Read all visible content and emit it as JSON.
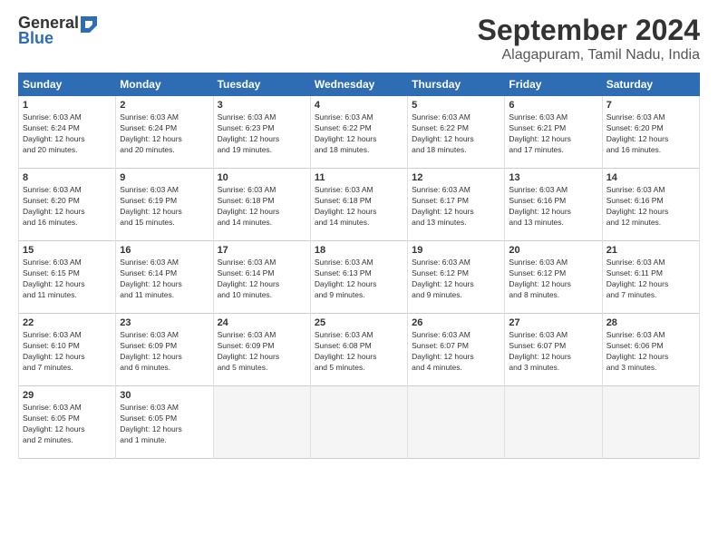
{
  "header": {
    "logo_line1": "General",
    "logo_line2": "Blue",
    "title": "September 2024",
    "subtitle": "Alagapuram, Tamil Nadu, India"
  },
  "calendar": {
    "days_of_week": [
      "Sunday",
      "Monday",
      "Tuesday",
      "Wednesday",
      "Thursday",
      "Friday",
      "Saturday"
    ],
    "weeks": [
      [
        null,
        {
          "day": "2",
          "sunrise": "Sunrise: 6:03 AM",
          "sunset": "Sunset: 6:24 PM",
          "daylight": "Daylight: 12 hours and 20 minutes."
        },
        {
          "day": "3",
          "sunrise": "Sunrise: 6:03 AM",
          "sunset": "Sunset: 6:23 PM",
          "daylight": "Daylight: 12 hours and 19 minutes."
        },
        {
          "day": "4",
          "sunrise": "Sunrise: 6:03 AM",
          "sunset": "Sunset: 6:22 PM",
          "daylight": "Daylight: 12 hours and 18 minutes."
        },
        {
          "day": "5",
          "sunrise": "Sunrise: 6:03 AM",
          "sunset": "Sunset: 6:22 PM",
          "daylight": "Daylight: 12 hours and 18 minutes."
        },
        {
          "day": "6",
          "sunrise": "Sunrise: 6:03 AM",
          "sunset": "Sunset: 6:21 PM",
          "daylight": "Daylight: 12 hours and 17 minutes."
        },
        {
          "day": "7",
          "sunrise": "Sunrise: 6:03 AM",
          "sunset": "Sunset: 6:20 PM",
          "daylight": "Daylight: 12 hours and 16 minutes."
        }
      ],
      [
        {
          "day": "1",
          "sunrise": "Sunrise: 6:03 AM",
          "sunset": "Sunset: 6:24 PM",
          "daylight": "Daylight: 12 hours and 20 minutes."
        },
        {
          "day": "9",
          "sunrise": "Sunrise: 6:03 AM",
          "sunset": "Sunset: 6:19 PM",
          "daylight": "Daylight: 12 hours and 15 minutes."
        },
        {
          "day": "10",
          "sunrise": "Sunrise: 6:03 AM",
          "sunset": "Sunset: 6:18 PM",
          "daylight": "Daylight: 12 hours and 14 minutes."
        },
        {
          "day": "11",
          "sunrise": "Sunrise: 6:03 AM",
          "sunset": "Sunset: 6:18 PM",
          "daylight": "Daylight: 12 hours and 14 minutes."
        },
        {
          "day": "12",
          "sunrise": "Sunrise: 6:03 AM",
          "sunset": "Sunset: 6:17 PM",
          "daylight": "Daylight: 12 hours and 13 minutes."
        },
        {
          "day": "13",
          "sunrise": "Sunrise: 6:03 AM",
          "sunset": "Sunset: 6:16 PM",
          "daylight": "Daylight: 12 hours and 13 minutes."
        },
        {
          "day": "14",
          "sunrise": "Sunrise: 6:03 AM",
          "sunset": "Sunset: 6:16 PM",
          "daylight": "Daylight: 12 hours and 12 minutes."
        }
      ],
      [
        {
          "day": "8",
          "sunrise": "Sunrise: 6:03 AM",
          "sunset": "Sunset: 6:20 PM",
          "daylight": "Daylight: 12 hours and 16 minutes."
        },
        {
          "day": "16",
          "sunrise": "Sunrise: 6:03 AM",
          "sunset": "Sunset: 6:14 PM",
          "daylight": "Daylight: 12 hours and 11 minutes."
        },
        {
          "day": "17",
          "sunrise": "Sunrise: 6:03 AM",
          "sunset": "Sunset: 6:14 PM",
          "daylight": "Daylight: 12 hours and 10 minutes."
        },
        {
          "day": "18",
          "sunrise": "Sunrise: 6:03 AM",
          "sunset": "Sunset: 6:13 PM",
          "daylight": "Daylight: 12 hours and 9 minutes."
        },
        {
          "day": "19",
          "sunrise": "Sunrise: 6:03 AM",
          "sunset": "Sunset: 6:12 PM",
          "daylight": "Daylight: 12 hours and 9 minutes."
        },
        {
          "day": "20",
          "sunrise": "Sunrise: 6:03 AM",
          "sunset": "Sunset: 6:12 PM",
          "daylight": "Daylight: 12 hours and 8 minutes."
        },
        {
          "day": "21",
          "sunrise": "Sunrise: 6:03 AM",
          "sunset": "Sunset: 6:11 PM",
          "daylight": "Daylight: 12 hours and 7 minutes."
        }
      ],
      [
        {
          "day": "15",
          "sunrise": "Sunrise: 6:03 AM",
          "sunset": "Sunset: 6:15 PM",
          "daylight": "Daylight: 12 hours and 11 minutes."
        },
        {
          "day": "23",
          "sunrise": "Sunrise: 6:03 AM",
          "sunset": "Sunset: 6:09 PM",
          "daylight": "Daylight: 12 hours and 6 minutes."
        },
        {
          "day": "24",
          "sunrise": "Sunrise: 6:03 AM",
          "sunset": "Sunset: 6:09 PM",
          "daylight": "Daylight: 12 hours and 5 minutes."
        },
        {
          "day": "25",
          "sunrise": "Sunrise: 6:03 AM",
          "sunset": "Sunset: 6:08 PM",
          "daylight": "Daylight: 12 hours and 5 minutes."
        },
        {
          "day": "26",
          "sunrise": "Sunrise: 6:03 AM",
          "sunset": "Sunset: 6:07 PM",
          "daylight": "Daylight: 12 hours and 4 minutes."
        },
        {
          "day": "27",
          "sunrise": "Sunrise: 6:03 AM",
          "sunset": "Sunset: 6:07 PM",
          "daylight": "Daylight: 12 hours and 3 minutes."
        },
        {
          "day": "28",
          "sunrise": "Sunrise: 6:03 AM",
          "sunset": "Sunset: 6:06 PM",
          "daylight": "Daylight: 12 hours and 3 minutes."
        }
      ],
      [
        {
          "day": "22",
          "sunrise": "Sunrise: 6:03 AM",
          "sunset": "Sunset: 6:10 PM",
          "daylight": "Daylight: 12 hours and 7 minutes."
        },
        {
          "day": "30",
          "sunrise": "Sunrise: 6:03 AM",
          "sunset": "Sunset: 6:05 PM",
          "daylight": "Daylight: 12 hours and 1 minute."
        },
        null,
        null,
        null,
        null,
        null
      ],
      [
        {
          "day": "29",
          "sunrise": "Sunrise: 6:03 AM",
          "sunset": "Sunset: 6:05 PM",
          "daylight": "Daylight: 12 hours and 2 minutes."
        },
        null,
        null,
        null,
        null,
        null,
        null
      ]
    ]
  }
}
